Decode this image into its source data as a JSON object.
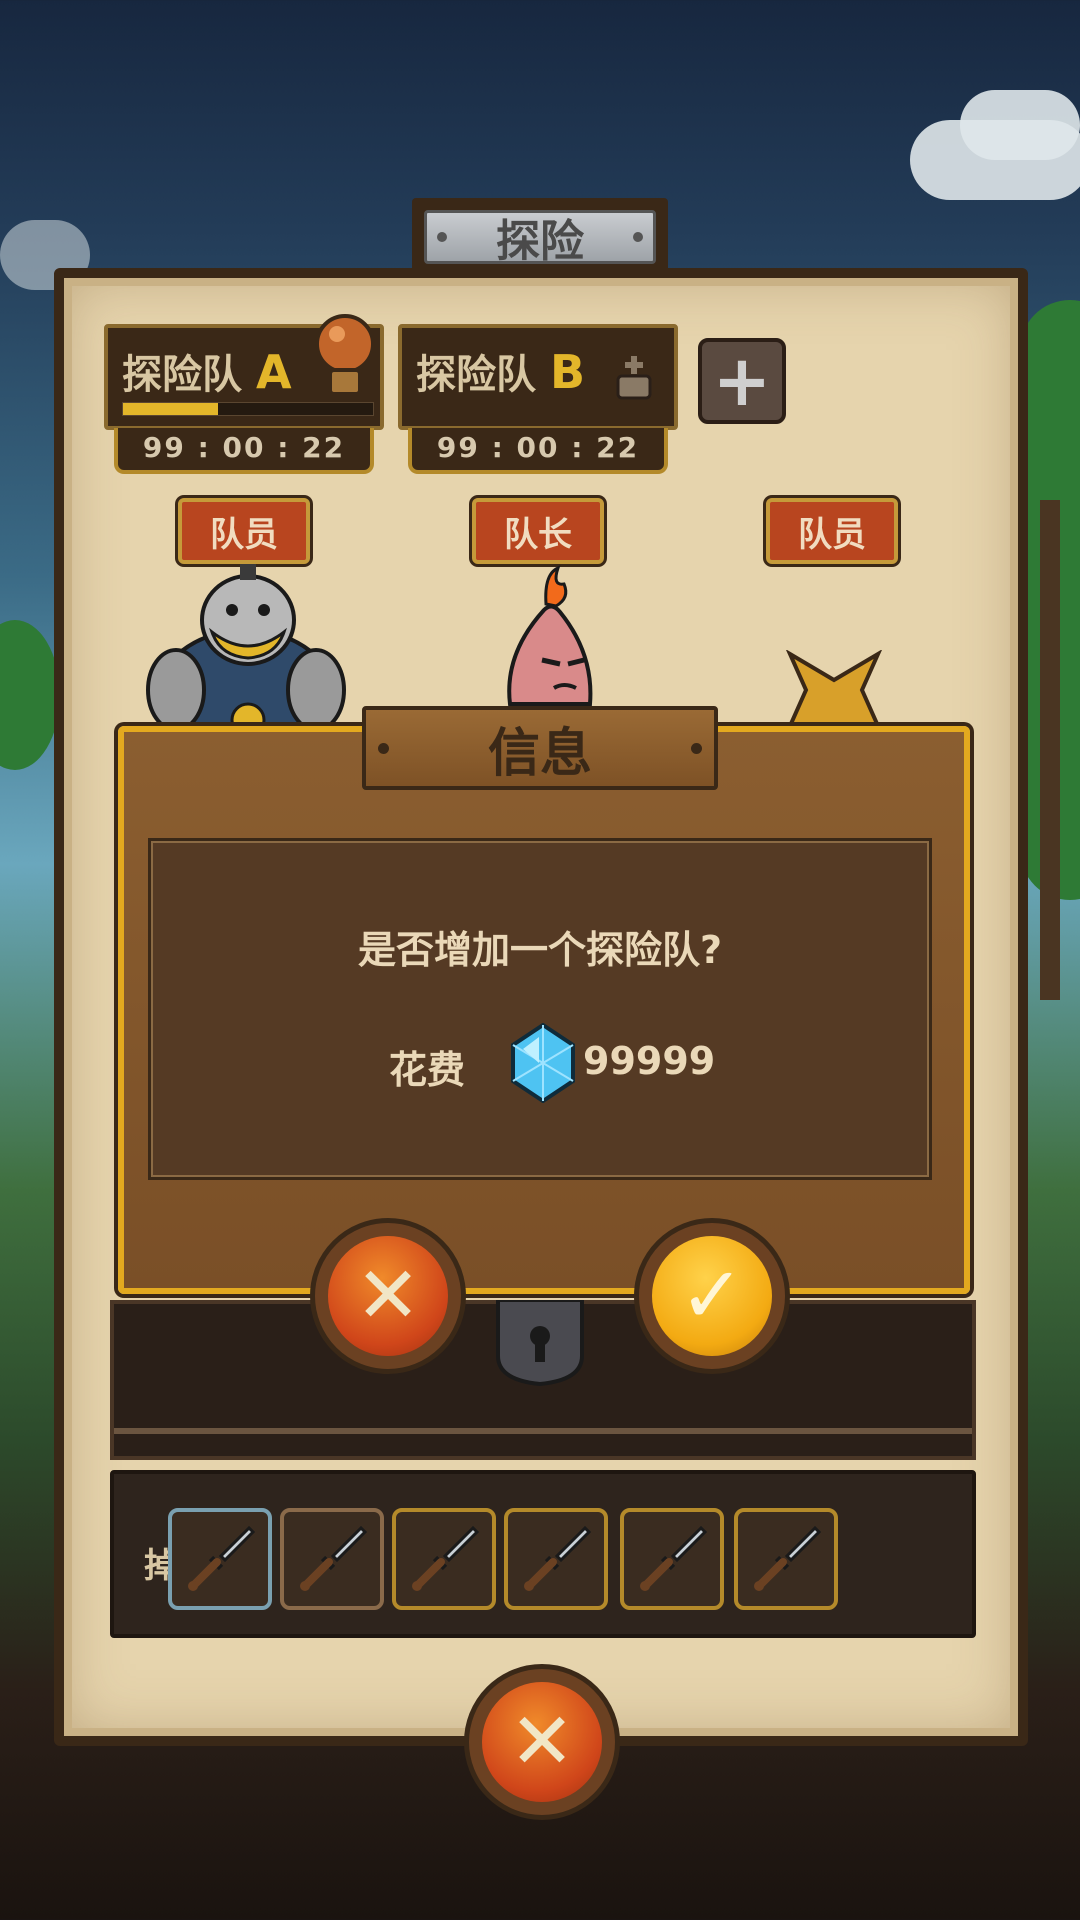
{
  "header": {
    "title": "探险"
  },
  "teams": [
    {
      "label": "探险队",
      "letter": "A",
      "timer": "99 : 00 : 22",
      "progress": 0.38
    },
    {
      "label": "探险队",
      "letter": "B",
      "timer": "99 : 00 : 22"
    }
  ],
  "add_team_icon": "plus-icon",
  "roles": [
    "队员",
    "队长",
    "队员"
  ],
  "drops": {
    "label": "掉落:",
    "items": [
      "dagger-icon",
      "dagger-icon",
      "dagger-icon",
      "dagger-icon",
      "dagger-icon",
      "dagger-icon"
    ]
  },
  "dialog": {
    "title": "信息",
    "question": "是否增加一个探险队?",
    "cost_label": "花费",
    "cost_icon": "diamond-icon",
    "cost_value": "99999",
    "cancel_icon": "close-icon",
    "confirm_icon": "check-icon"
  },
  "close_icon": "close-icon",
  "colors": {
    "accent": "#e3a91f",
    "board": "#e6d4ad",
    "cancel": "#d0461a",
    "confirm": "#f3aa12"
  }
}
